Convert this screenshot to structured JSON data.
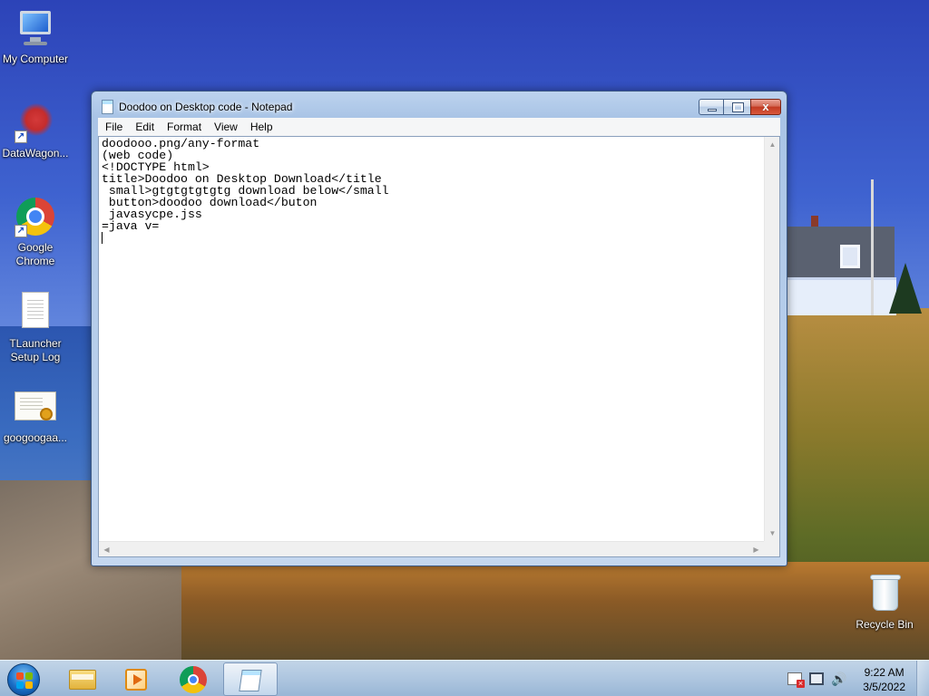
{
  "desktop": {
    "icons": [
      {
        "label": "My Computer",
        "icon": "computer-icon"
      },
      {
        "label": "DataWagon...",
        "icon": "datawagon-icon"
      },
      {
        "label": "Google Chrome",
        "icon": "chrome-icon"
      },
      {
        "label": "TLauncher Setup Log",
        "icon": "text-document-icon"
      },
      {
        "label": "googoogaa...",
        "icon": "certificate-icon"
      },
      {
        "label": "Recycle Bin",
        "icon": "recycle-bin-icon"
      }
    ]
  },
  "window": {
    "title": "Doodoo on Desktop code - Notepad",
    "close_glyph": "x",
    "menu": [
      "File",
      "Edit",
      "Format",
      "View",
      "Help"
    ],
    "lines": [
      "doodooo.png/any-format",
      "(web code)",
      "<!DOCTYPE html>",
      "title>Doodoo on Desktop Download</title",
      " small>gtgtgtgtgtg download below</small",
      " button>doodoo download</buton",
      " javasycpe.jss",
      "=java v="
    ],
    "scroll_arrows": {
      "up": "▲",
      "down": "▼",
      "left": "◀",
      "right": "▶"
    }
  },
  "taskbar": {
    "items": [
      {
        "name": "windows-explorer",
        "icon": "folder-icon",
        "active": false
      },
      {
        "name": "media-player",
        "icon": "media-player-icon",
        "active": false
      },
      {
        "name": "google-chrome",
        "icon": "chrome-icon",
        "active": false
      },
      {
        "name": "notepad",
        "icon": "notepad-icon",
        "active": true
      }
    ],
    "tray": {
      "volume_glyph": "🔊",
      "time": "9:22 AM",
      "date": "3/5/2022"
    }
  },
  "colors": {
    "titlebar": "#b3cbea",
    "close_button": "#c9452c",
    "taskbar": "#a9c3de",
    "editor_bg": "#ffffff"
  }
}
